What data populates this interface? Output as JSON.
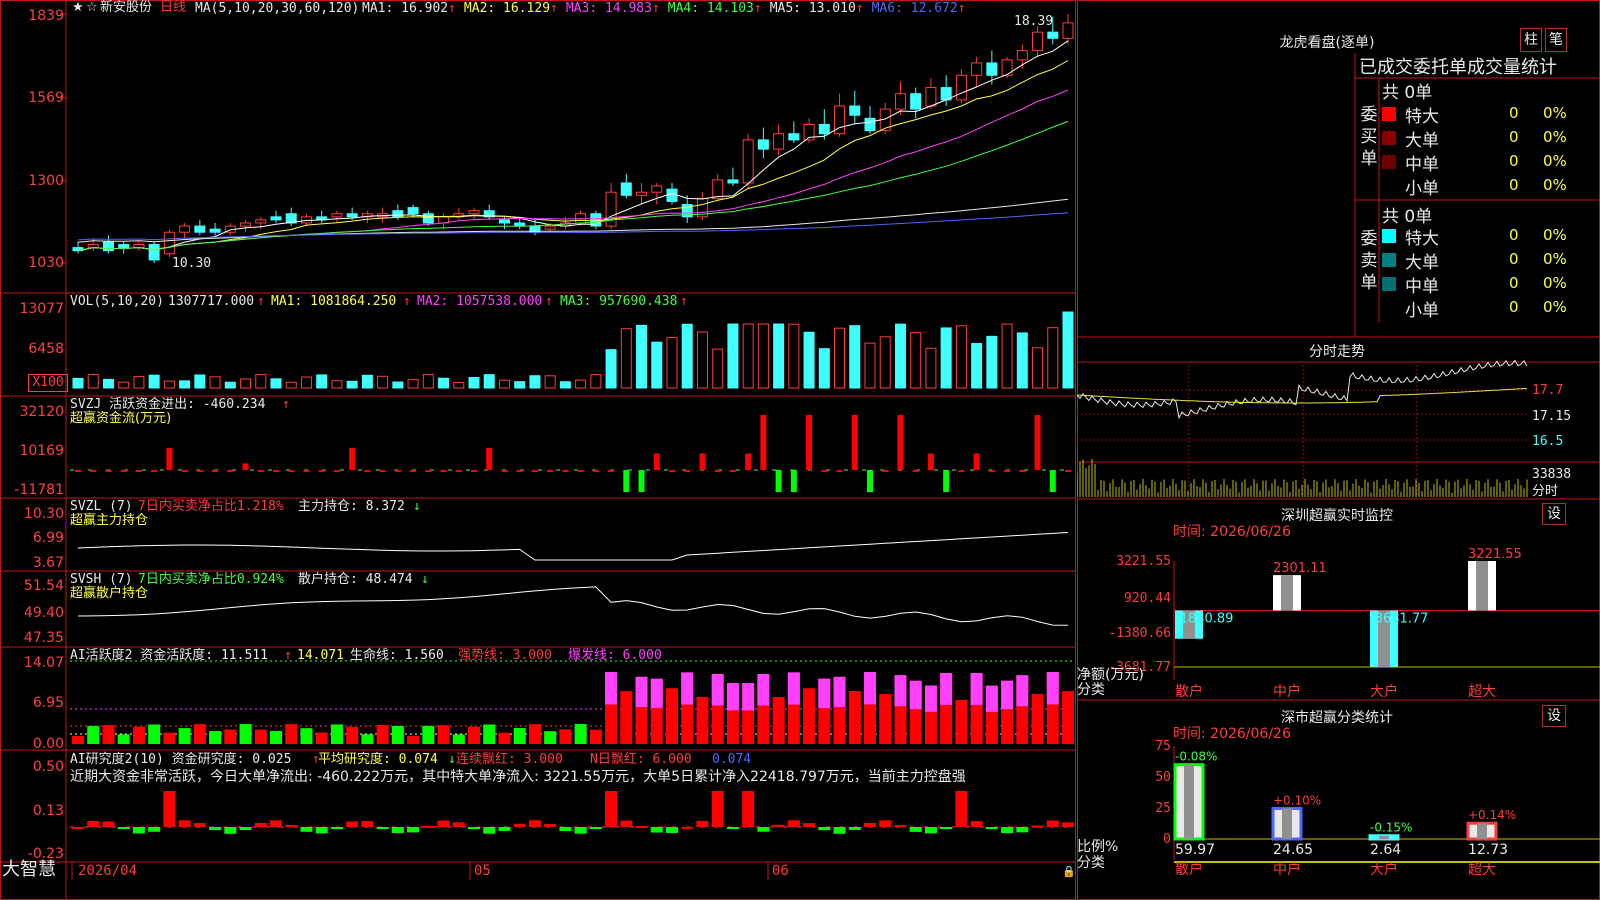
{
  "main": {
    "stock_name": "新安股份",
    "period": "日线",
    "ma_prefix": "MA(5,10,20,30,60,120)",
    "ma": [
      {
        "label": "MA1: 16.902",
        "color": "#e8e8e8"
      },
      {
        "label": "MA2: 16.129",
        "color": "#ffff40"
      },
      {
        "label": "MA3: 14.983",
        "color": "#ff40ff"
      },
      {
        "label": "MA4: 14.103",
        "color": "#40ff40"
      },
      {
        "label": "MA5: 13.010",
        "color": "#e8e8e8"
      },
      {
        "label": "MA6: 12.672",
        "color": "#4f66ff"
      }
    ],
    "arrow_up": "↑",
    "arrow_down": "↓",
    "yticks": [
      "1839",
      "1569",
      "1300",
      "1030"
    ],
    "high_label": "18.39",
    "low_label": "10.30"
  },
  "vol": {
    "header": "VOL(5,10,20)",
    "value": "1307717.000",
    "ma1": "MA1: 1081864.250",
    "ma2": "MA2: 1057538.000",
    "ma3": "MA3: 957690.438",
    "yticks": [
      "13077",
      "6458"
    ],
    "unit": "X100"
  },
  "svzj": {
    "header": "SVZJ  活跃资金进出: -460.234",
    "sub": "超赢资金流(万元)",
    "yticks": [
      "32120",
      "10169",
      "-11781"
    ]
  },
  "svzl": {
    "header_a": "SVZL (7) ",
    "header_b": "7日内买卖净占比1.218%",
    "header_c": " 主力持仓: 8.372",
    "sub": "超赢主力持仓",
    "yticks": [
      "10.30",
      "6.99",
      "3.67"
    ]
  },
  "svsh": {
    "header_a": "SVSH (7) ",
    "header_b": "7日内买卖净占比0.924%",
    "header_c": " 散户持仓: 48.474",
    "sub": "超赢散户持仓",
    "yticks": [
      "51.54",
      "49.40",
      "47.35"
    ]
  },
  "ai_active": {
    "header_a": "AI活跃度2 资金活跃度: 11.511",
    "header_b": "14.071",
    "header_c": " 生命线: 1.560",
    "header_d": " 强势线: 3.000",
    "header_e": " 爆发线: 6.000",
    "yticks": [
      "14.07",
      "6.95",
      "0.00"
    ]
  },
  "ai_research": {
    "header_a": "AI研究度2(10) 资金研究度: 0.025",
    "header_b": " 平均研究度: 0.074",
    "header_c": " 连续飘红: 3.000",
    "header_d": " N日飘红: 6.000",
    "header_e": " 0.074",
    "comment": "近期大资金非常活跃，今日大单净流出: -460.222万元，其中特大单净流入: 3221.55万元，大单5日累计净入22418.797万元，当前主力控盘强",
    "yticks": [
      "0.50",
      "0.13",
      "-0.23"
    ]
  },
  "xaxis": {
    "labels": [
      "2026/04",
      "05",
      "06"
    ]
  },
  "brand": "大智慧",
  "longhu": {
    "title": "龙虎看盘(逐单)",
    "btn_zhu": "柱",
    "btn_bi": "笔",
    "header": "已成交委托单成交量统计",
    "buy_label": "委买单",
    "sell_label": "委卖单",
    "buy_total": "共 0单",
    "sell_total": "共 0单",
    "buy_rows": [
      {
        "name": "特大",
        "count": "0",
        "pct": "0%",
        "color": "#ff0000"
      },
      {
        "name": "大单",
        "count": "0",
        "pct": "0%",
        "color": "#8a0000"
      },
      {
        "name": "中单",
        "count": "0",
        "pct": "0%",
        "color": "#6a0000"
      },
      {
        "name": "小单",
        "count": "0",
        "pct": "0%",
        "color": ""
      }
    ],
    "sell_rows": [
      {
        "name": "特大",
        "count": "0",
        "pct": "0%",
        "color": "#00ffff"
      },
      {
        "name": "大单",
        "count": "0",
        "pct": "0%",
        "color": "#008080"
      },
      {
        "name": "中单",
        "count": "0",
        "pct": "0%",
        "color": "#007070"
      },
      {
        "name": "小单",
        "count": "0",
        "pct": "0%",
        "color": ""
      }
    ]
  },
  "intraday": {
    "title": "分时走势",
    "yticks": [
      "17.7",
      "17.15",
      "16.5"
    ],
    "vol_label": "33838",
    "vol_name": "分时"
  },
  "sz_monitor": {
    "title": "深圳超赢实时监控",
    "settings": "设",
    "time_label": "时间: 2026/06/26",
    "yticks": [
      "3221.55",
      "920.44",
      "-1380.66",
      "-3681.77"
    ],
    "ylabel_a": "净额(万元)",
    "ylabel_b": "分类",
    "categories": [
      "散户",
      "中户",
      "大户",
      "超大"
    ],
    "values": [
      -1840.89,
      2301.11,
      -3681.77,
      3221.55
    ],
    "value_labels": [
      "-1840.89",
      "2301.11",
      "-3681.77",
      "3221.55"
    ]
  },
  "class_stats": {
    "title": "深市超赢分类统计",
    "settings": "设",
    "time_label": "时间: 2026/06/26",
    "yticks": [
      "75",
      "50",
      "25",
      "0"
    ],
    "ylabel_a": "比例%",
    "ylabel_b": "分类",
    "categories": [
      "散户",
      "中户",
      "大户",
      "超大"
    ],
    "values": [
      59.97,
      24.65,
      2.64,
      12.73
    ],
    "changes": [
      "-0.08%",
      "+0.10%",
      "-0.15%",
      "+0.14%"
    ]
  },
  "chart_data": [
    {
      "type": "candlestick",
      "title": "新安股份 日线",
      "ylim": [
        10.3,
        18.39
      ],
      "yticks": [
        18.39,
        15.69,
        13.0,
        10.3
      ],
      "x": [
        "2026/04",
        "05",
        "06"
      ],
      "ohlc_approx": [
        [
          10.8,
          11.0,
          10.6,
          10.7
        ],
        [
          10.8,
          11.1,
          10.7,
          10.9
        ],
        [
          11.0,
          11.2,
          10.6,
          10.7
        ],
        [
          10.9,
          11.0,
          10.6,
          10.8
        ],
        [
          10.8,
          11.0,
          10.7,
          10.9
        ],
        [
          10.9,
          11.0,
          10.3,
          10.4
        ],
        [
          10.6,
          11.4,
          10.5,
          11.3
        ],
        [
          11.3,
          11.6,
          11.1,
          11.5
        ],
        [
          11.5,
          11.7,
          11.2,
          11.3
        ],
        [
          11.4,
          11.6,
          11.2,
          11.3
        ],
        [
          11.3,
          11.6,
          11.2,
          11.5
        ],
        [
          11.5,
          11.7,
          11.3,
          11.6
        ],
        [
          11.6,
          11.8,
          11.4,
          11.7
        ],
        [
          11.8,
          12.0,
          11.6,
          11.7
        ],
        [
          11.9,
          12.1,
          11.5,
          11.6
        ],
        [
          11.6,
          11.9,
          11.5,
          11.8
        ],
        [
          11.8,
          12.0,
          11.6,
          11.7
        ],
        [
          11.8,
          12.0,
          11.6,
          11.9
        ],
        [
          11.9,
          12.1,
          11.7,
          11.8
        ],
        [
          11.8,
          12.0,
          11.6,
          11.9
        ],
        [
          11.8,
          12.1,
          11.6,
          11.9
        ],
        [
          12.0,
          12.2,
          11.7,
          11.8
        ],
        [
          12.1,
          12.2,
          11.8,
          11.9
        ],
        [
          11.9,
          12.0,
          11.5,
          11.6
        ],
        [
          11.6,
          11.9,
          11.4,
          11.8
        ],
        [
          11.8,
          12.1,
          11.7,
          11.9
        ],
        [
          11.9,
          12.1,
          11.7,
          12.0
        ],
        [
          12.0,
          12.2,
          11.7,
          11.8
        ],
        [
          11.7,
          11.8,
          11.4,
          11.6
        ],
        [
          11.6,
          11.8,
          11.4,
          11.5
        ],
        [
          11.5,
          11.7,
          11.2,
          11.3
        ],
        [
          11.4,
          11.6,
          11.3,
          11.5
        ],
        [
          11.5,
          11.8,
          11.4,
          11.6
        ],
        [
          11.6,
          12.0,
          11.5,
          11.9
        ],
        [
          11.9,
          12.0,
          11.4,
          11.5
        ],
        [
          11.5,
          12.9,
          11.4,
          12.6
        ],
        [
          12.9,
          13.2,
          12.4,
          12.5
        ],
        [
          12.5,
          12.9,
          12.2,
          12.6
        ],
        [
          12.6,
          12.9,
          12.2,
          12.8
        ],
        [
          12.7,
          12.9,
          12.2,
          12.3
        ],
        [
          12.2,
          12.5,
          11.6,
          11.8
        ],
        [
          11.8,
          12.6,
          11.7,
          12.4
        ],
        [
          12.4,
          13.2,
          12.3,
          13.0
        ],
        [
          13.0,
          13.4,
          12.8,
          12.9
        ],
        [
          12.9,
          14.5,
          12.7,
          14.3
        ],
        [
          14.3,
          14.7,
          13.7,
          14.0
        ],
        [
          14.0,
          14.8,
          13.8,
          14.5
        ],
        [
          14.5,
          14.9,
          14.2,
          14.3
        ],
        [
          14.3,
          15.0,
          14.2,
          14.8
        ],
        [
          14.8,
          15.3,
          14.3,
          14.5
        ],
        [
          14.5,
          15.8,
          14.4,
          15.4
        ],
        [
          15.4,
          15.9,
          14.8,
          15.1
        ],
        [
          15.0,
          15.4,
          14.5,
          14.6
        ],
        [
          14.6,
          15.5,
          14.5,
          15.3
        ],
        [
          15.3,
          16.2,
          15.1,
          15.8
        ],
        [
          15.8,
          16.0,
          15.0,
          15.3
        ],
        [
          15.4,
          16.3,
          15.3,
          16.0
        ],
        [
          16.0,
          16.4,
          15.4,
          15.6
        ],
        [
          15.6,
          16.6,
          15.5,
          16.4
        ],
        [
          16.4,
          17.0,
          16.0,
          16.8
        ],
        [
          16.8,
          17.2,
          16.1,
          16.4
        ],
        [
          16.4,
          17.0,
          16.3,
          16.9
        ],
        [
          16.9,
          17.4,
          16.6,
          17.2
        ],
        [
          17.2,
          18.0,
          17.0,
          17.8
        ],
        [
          17.8,
          18.3,
          17.4,
          17.6
        ],
        [
          17.6,
          18.39,
          17.4,
          18.1
        ]
      ]
    },
    {
      "type": "bar",
      "title": "深圳超赢实时监控",
      "categories": [
        "散户",
        "中户",
        "大户",
        "超大"
      ],
      "values": [
        -1840.89,
        2301.11,
        -3681.77,
        3221.55
      ],
      "ylabel": "净额(万元)",
      "ylim": [
        -3681.77,
        3221.55
      ]
    },
    {
      "type": "bar",
      "title": "深市超赢分类统计",
      "categories": [
        "散户",
        "中户",
        "大户",
        "超大"
      ],
      "values": [
        59.97,
        24.65,
        2.64,
        12.73
      ],
      "ylabel": "比例%",
      "ylim": [
        0,
        75
      ]
    }
  ]
}
